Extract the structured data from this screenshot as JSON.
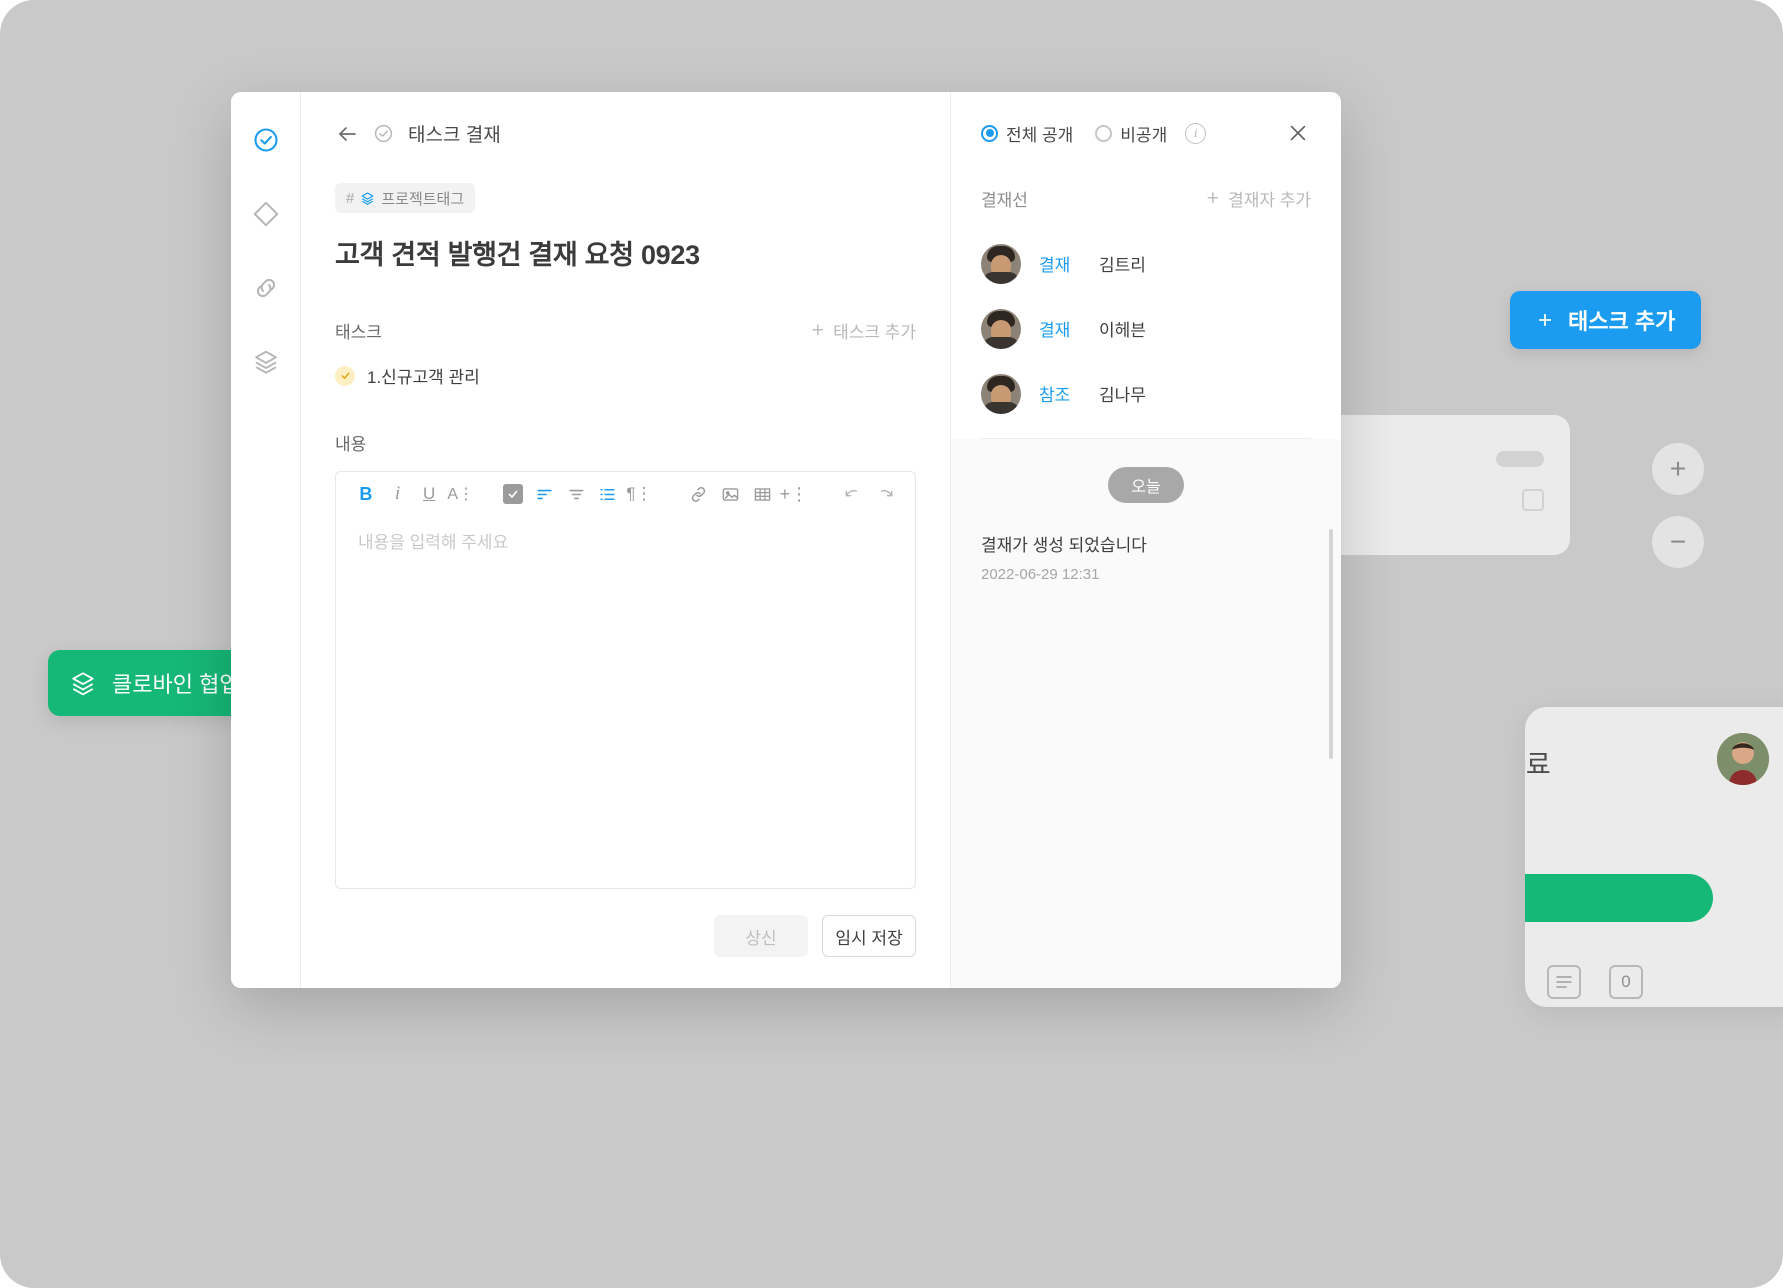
{
  "background": {
    "green_banner": {
      "label": "클로바인 협업 제품",
      "icon": "layers-icon",
      "color": "#16b877"
    },
    "add_task_button": {
      "label": "태스크 추가",
      "icon": "plus-icon",
      "color": "#1b9cf0"
    },
    "zoom_in_label": "+",
    "zoom_out_label": "−",
    "bottom_card": {
      "title": "자료",
      "counter": "0"
    }
  },
  "modal": {
    "rail": {
      "items": [
        {
          "name": "check-circle-icon",
          "active": true
        },
        {
          "name": "diamond-icon",
          "active": false
        },
        {
          "name": "link-icon",
          "active": false
        },
        {
          "name": "layers-icon",
          "active": false
        }
      ]
    },
    "breadcrumb": {
      "back_icon": "arrow-left-icon",
      "status_icon": "check-circle-icon",
      "label": "태스크 결재"
    },
    "tag": {
      "hash": "#",
      "icon": "layers-icon",
      "label": "프로젝트태그"
    },
    "title": "고객 견적 발행건 결재 요청 0923",
    "task_section": {
      "label": "태스크",
      "add_label": "태스크 추가",
      "items": [
        {
          "label": "1.신규고객 관리",
          "check_icon": "check-icon",
          "state": "pending"
        }
      ]
    },
    "content_section": {
      "label": "내용",
      "placeholder": "내용을 입력해 주세요",
      "value": "",
      "toolbar": [
        {
          "name": "bold-icon",
          "glyph": "B",
          "color": "blue"
        },
        {
          "name": "italic-icon",
          "glyph": "i",
          "color": "gray"
        },
        {
          "name": "underline-icon",
          "glyph": "U",
          "color": "gray"
        },
        {
          "name": "font-size-icon",
          "glyph": "A",
          "color": "gray"
        },
        {
          "name": "checklist-icon",
          "glyph": "☑",
          "color": "filled"
        },
        {
          "name": "align-left-icon",
          "glyph": "≡",
          "color": "blue"
        },
        {
          "name": "align-center-icon",
          "glyph": "≡",
          "color": "gray"
        },
        {
          "name": "ordered-list-icon",
          "glyph": "≔",
          "color": "blue"
        },
        {
          "name": "paragraph-icon",
          "glyph": "¶",
          "color": "gray"
        },
        {
          "name": "link-icon",
          "glyph": "🔗",
          "color": "gray"
        },
        {
          "name": "image-icon",
          "glyph": "🖼",
          "color": "gray"
        },
        {
          "name": "table-icon",
          "glyph": "▦",
          "color": "gray"
        },
        {
          "name": "insert-icon",
          "glyph": "+",
          "color": "gray"
        },
        {
          "name": "undo-icon",
          "glyph": "↶",
          "color": "gray"
        },
        {
          "name": "redo-icon",
          "glyph": "↷",
          "color": "gray"
        }
      ]
    },
    "actions": {
      "submit_label": "상신",
      "submit_disabled": true,
      "save_draft_label": "임시 저장"
    },
    "right_panel": {
      "visibility": {
        "public_label": "전체 공개",
        "private_label": "비공개",
        "selected": "public",
        "info_icon": "info-icon"
      },
      "close_icon": "close-icon",
      "approval_line": {
        "label": "결재선",
        "add_label": "결재자 추가",
        "add_icon": "plus-icon",
        "members": [
          {
            "role": "결재",
            "name": "김트리",
            "avatar": "user-avatar"
          },
          {
            "role": "결재",
            "name": "이헤븐",
            "avatar": "user-avatar"
          },
          {
            "role": "참조",
            "name": "김나무",
            "avatar": "user-avatar"
          }
        ]
      },
      "feed": {
        "date_chip": "오늘",
        "entries": [
          {
            "text": "결재가 생성 되었습니다",
            "time": "2022-06-29 12:31"
          }
        ]
      }
    }
  },
  "colors": {
    "accent_blue": "#1b9cf0",
    "accent_green": "#16b877",
    "canvas_gray": "#c9c9c9"
  }
}
